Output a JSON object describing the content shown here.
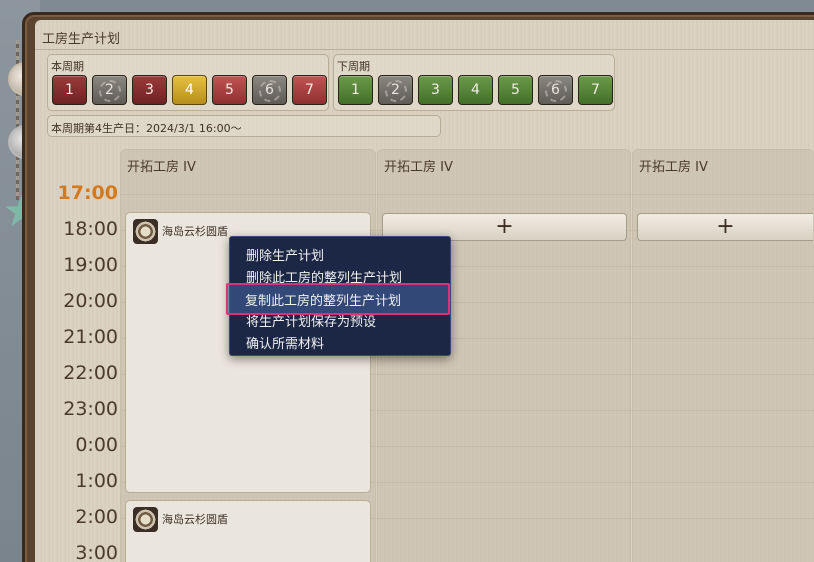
{
  "window": {
    "title": "工房生产计划"
  },
  "this_week": {
    "label": "本周期",
    "days": [
      "1",
      "2",
      "3",
      "4",
      "5",
      "6",
      "7"
    ],
    "selected_index": 3
  },
  "next_week": {
    "label": "下周期",
    "days": [
      "1",
      "2",
      "3",
      "4",
      "5",
      "6",
      "7"
    ]
  },
  "start_date": "本周期第4生产日：2024/3/1 16:00～",
  "times": [
    "17:00",
    "18:00",
    "19:00",
    "20:00",
    "21:00",
    "22:00",
    "23:00",
    "0:00",
    "1:00",
    "2:00",
    "3:00"
  ],
  "columns": [
    {
      "header": "开拓工房 IV"
    },
    {
      "header": "开拓工房 IV"
    },
    {
      "header": "开拓工房 IV"
    }
  ],
  "add_symbol": "+",
  "plans": [
    {
      "name": "海岛云杉圆盾"
    },
    {
      "name": "海岛云杉圆盾"
    }
  ],
  "context_menu": {
    "items": [
      "删除生产计划",
      "删除此工房的整列生产计划",
      "复制此工房的整列生产计划",
      "将生产计划保存为预设",
      "确认所需材料"
    ],
    "highlighted_index": 2
  },
  "colors": {
    "accent_highlight": "#d6337a",
    "current_time": "#d57a1c",
    "menu_bg": "#1b2745",
    "selected_day": "#e6c13e"
  }
}
